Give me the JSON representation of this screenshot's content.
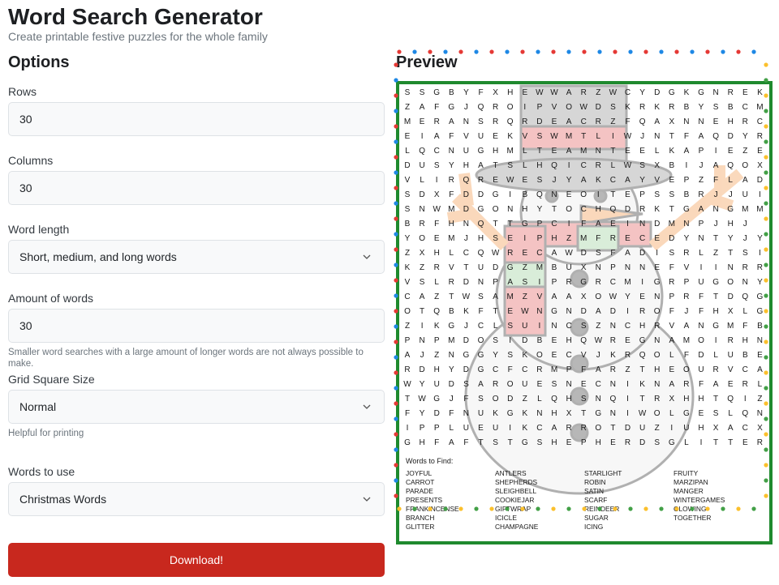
{
  "header": {
    "title": "Word Search Generator",
    "subtitle": "Create printable festive puzzles for the whole family"
  },
  "options": {
    "heading": "Options",
    "rows": {
      "label": "Rows",
      "value": "30"
    },
    "columns": {
      "label": "Columns",
      "value": "30"
    },
    "word_length": {
      "label": "Word length",
      "value": "Short, medium, and long words"
    },
    "amount": {
      "label": "Amount of words",
      "value": "30",
      "help": "Smaller word searches with a large amount of longer words are not always possible to make."
    },
    "grid_size": {
      "label": "Grid Square Size",
      "value": "Normal",
      "help": "Helpful for printing"
    },
    "words_to_use": {
      "label": "Words to use",
      "value": "Christmas Words"
    },
    "download_label": "Download!"
  },
  "preview": {
    "heading": "Preview",
    "grid": [
      "SSGBYFXHEWWARZWCYDGKGNREK",
      "ZAFGJQROIPVOWDSKRKRBYSBCM",
      "MERANSRQRDEACRZFQAXNNEHRC",
      "EIAFVUEKVSWMTLIWJNTFAQDYR",
      "LQCNUGHMLTEAMNTEELKAPIEZE",
      "DUSYHATSLHQICRLWSXBIJAQOX",
      "VLIRQREWESJYAKCAYVEPZFLAD",
      "SDXFDDGIBQNEOITEPSSBRJJUI",
      "SNWMDGONHYTOCHQDRKTGANGMM",
      "BRFHNQTTGPCIFAEINDMNPJHJ",
      "YOEMJHSEIPHZMFRECEDYNTYJY",
      "ZXHLCQWRECAWDSFADISRLZTSI",
      "KZRVTUDGZMBUXNPNNEFVIINRR",
      "VSLRDNPASIPRGRCMIGRPUGONY",
      "CAZTWSAMZVAAXOWYENPRFTDQG",
      "OTQBKFTEWNGNDADIROFJFHXLG",
      "ZIKGJCLSUINCSZNCHRVANGMFB",
      "PNPMDOSIDBEHQWREGNAMOIRHN",
      "AJZNGGYSKOECVJKRQOLFDLUBE",
      "RDHYDGCFCRMPFARZTHEOURVCA",
      "WYUDSAROUESNECNIKNARFAERL",
      "TWGJFSODZLQHSNQITRXHHTQIZ",
      "FYDFNUKGKNHXTGNIWOLGESLQN",
      "IPPLUEUIKCARROTDUZIUHXACX",
      "GHFAFTSTGSHEPHERDSGLITTER"
    ],
    "words_title": "Words to Find:",
    "words": [
      [
        "JOYFUL",
        "CARROT",
        "PARADE",
        "PRESENTS",
        "FRANKINCENSE",
        "BRANCH",
        "GLITTER"
      ],
      [
        "ANTLERS",
        "SHEPHERDS",
        "SLEIGHBELL",
        "COOKIEJAR",
        "GIFTWRAP",
        "ICICLE",
        "CHAMPAGNE"
      ],
      [
        "STARLIGHT",
        "ROBIN",
        "SATIN",
        "SCARF",
        "REINDEER",
        "SUGAR",
        "ICING"
      ],
      [
        "FRUITY",
        "MARZIPAN",
        "MANGER",
        "WINTERGAMES",
        "GLOWING",
        "TOGETHER"
      ]
    ],
    "frame_color": "#1f8a2e",
    "light_colors": [
      "#e53935",
      "#fbc02d",
      "#1e88e5",
      "#43a047"
    ]
  },
  "colors": {
    "download_bg": "#c8281e",
    "input_bg": "#f8f9fa"
  }
}
